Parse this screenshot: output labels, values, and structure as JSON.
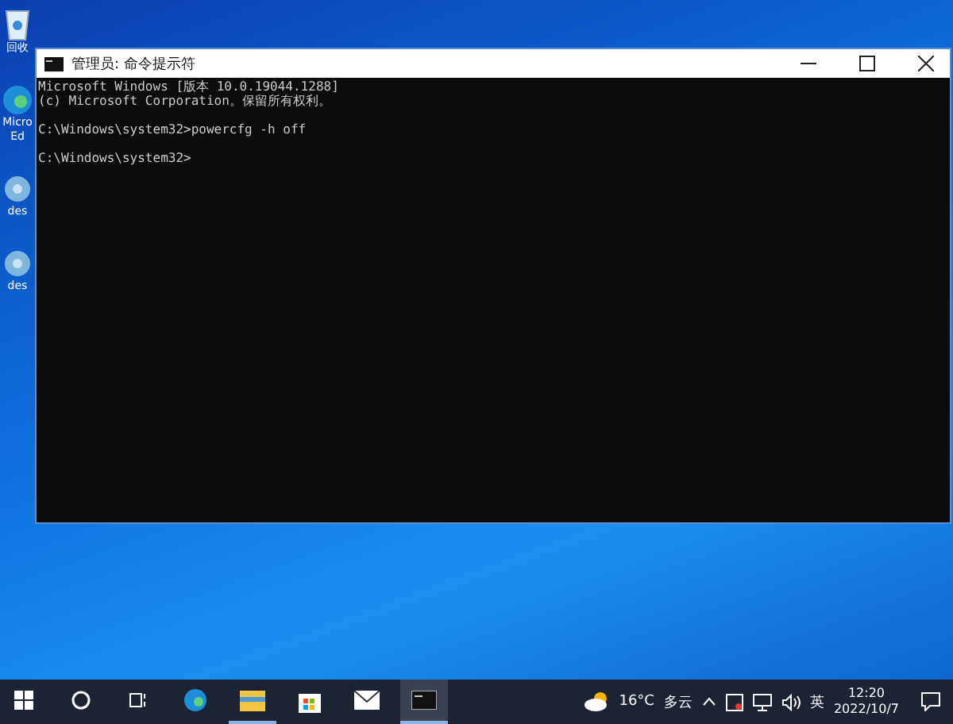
{
  "desktop_icons": [
    {
      "kind": "recycle",
      "label": "回收"
    },
    {
      "kind": "edge",
      "label": "Micro Ed"
    },
    {
      "kind": "gear",
      "label": "des"
    },
    {
      "kind": "gear",
      "label": "des"
    }
  ],
  "window": {
    "title": "管理员: 命令提示符",
    "paragraphs": [
      [
        "Microsoft Windows [版本 10.0.19044.1288]",
        "(c) Microsoft Corporation。保留所有权利。"
      ],
      [
        "C:\\Windows\\system32>powercfg -h off"
      ],
      [
        "C:\\Windows\\system32>"
      ]
    ]
  },
  "taskbar": {
    "apps": [
      {
        "kind": "edge",
        "active": false
      },
      {
        "kind": "folder",
        "active": true
      },
      {
        "kind": "store",
        "active": false
      },
      {
        "kind": "mail",
        "active": false
      },
      {
        "kind": "cmd",
        "active": true
      }
    ],
    "weather": {
      "temperature": "16°C",
      "condition": "多云"
    },
    "ime": "英",
    "time": "12:20",
    "date": "2022/10/7"
  }
}
